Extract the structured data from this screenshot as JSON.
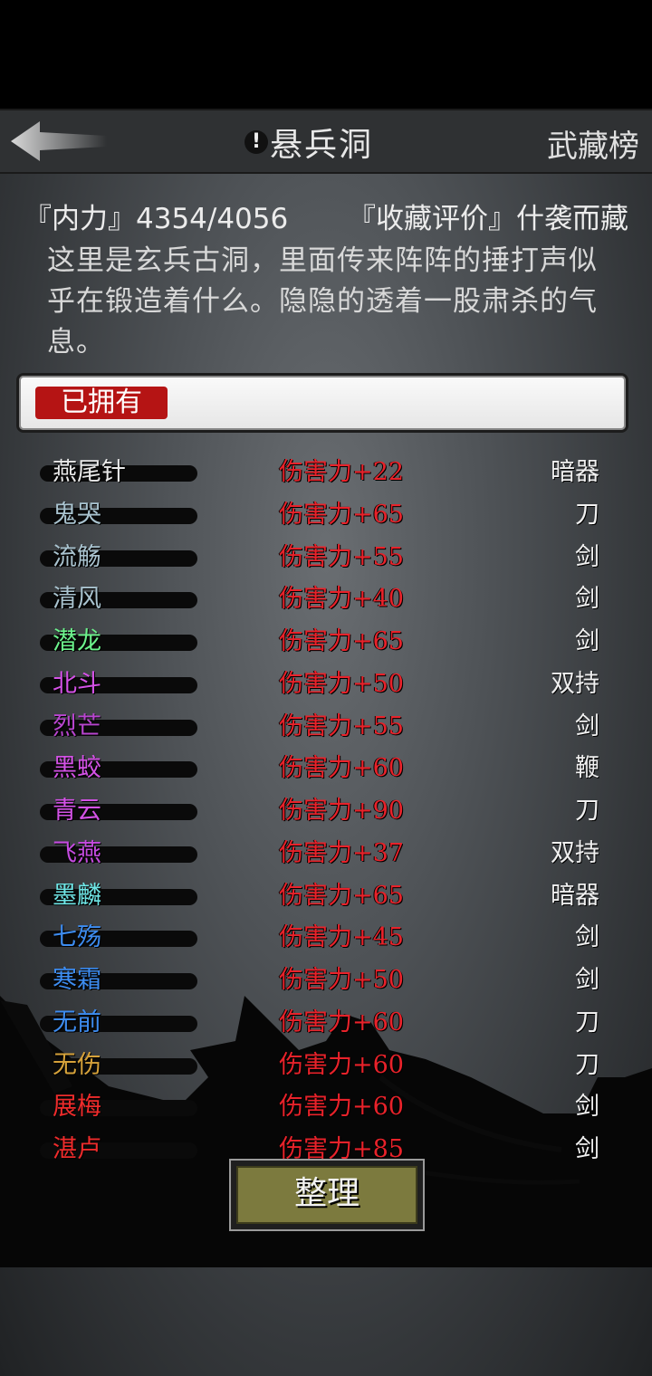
{
  "header": {
    "title": "悬兵洞",
    "right_link": "武藏榜",
    "alert_glyph": "!"
  },
  "stats": {
    "internal_power": "『内力』4354/4056",
    "collection_rating": "『收藏评价』什袭而藏"
  },
  "description": "这里是玄兵古洞，里面传来阵阵的捶打声似乎在锻造着什么。隐隐的透着一股肃杀的气息。",
  "filter": {
    "active_tab": "已拥有"
  },
  "weapons": [
    {
      "name": "燕尾针",
      "damage": "伤害力+22",
      "type": "暗器",
      "color": "#e8e8e8"
    },
    {
      "name": "鬼哭",
      "damage": "伤害力+65",
      "type": "刀",
      "color": "#a9c3cf"
    },
    {
      "name": "流觞",
      "damage": "伤害力+55",
      "type": "剑",
      "color": "#a9c3cf"
    },
    {
      "name": "清风",
      "damage": "伤害力+40",
      "type": "剑",
      "color": "#a9c3cf"
    },
    {
      "name": "潜龙",
      "damage": "伤害力+65",
      "type": "剑",
      "color": "#6cf28c"
    },
    {
      "name": "北斗",
      "damage": "伤害力+50",
      "type": "双持",
      "color": "#d452e6"
    },
    {
      "name": "烈芒",
      "damage": "伤害力+55",
      "type": "剑",
      "color": "#b845cf"
    },
    {
      "name": "黑蛟",
      "damage": "伤害力+60",
      "type": "鞭",
      "color": "#d452e6"
    },
    {
      "name": "青云",
      "damage": "伤害力+90",
      "type": "刀",
      "color": "#d452e6"
    },
    {
      "name": "飞燕",
      "damage": "伤害力+37",
      "type": "双持",
      "color": "#c54be0"
    },
    {
      "name": "墨麟",
      "damage": "伤害力+65",
      "type": "暗器",
      "color": "#6fe6e6"
    },
    {
      "name": "七殇",
      "damage": "伤害力+45",
      "type": "剑",
      "color": "#3d8cf0"
    },
    {
      "name": "寒霜",
      "damage": "伤害力+50",
      "type": "剑",
      "color": "#3d8cf0"
    },
    {
      "name": "无前",
      "damage": "伤害力+60",
      "type": "刀",
      "color": "#3d8cf0"
    },
    {
      "name": "无伤",
      "damage": "伤害力+60",
      "type": "刀",
      "color": "#d6a23a"
    },
    {
      "name": "展梅",
      "damage": "伤害力+60",
      "type": "剑",
      "color": "#ee2b2b"
    },
    {
      "name": "湛卢",
      "damage": "伤害力+85",
      "type": "剑",
      "color": "#ee2b2b"
    }
  ],
  "sort_button": "整理"
}
